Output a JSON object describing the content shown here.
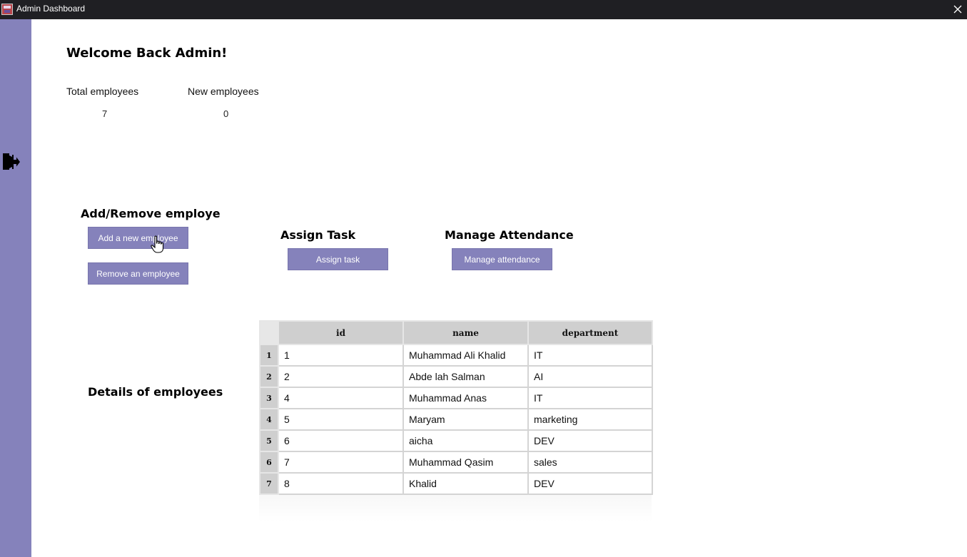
{
  "window": {
    "title": "Admin Dashboard",
    "close_icon": "close-icon",
    "app_icon": "app-icon"
  },
  "sidebar": {
    "color": "#8582bb",
    "logout_icon": "logout-icon"
  },
  "header": {
    "welcome": "Welcome Back Admin!"
  },
  "stats": {
    "total_label": "Total employees",
    "total_value": "7",
    "new_label": "New employees",
    "new_value": "0"
  },
  "add_remove": {
    "title": "Add/Remove employe",
    "add_label": "Add a new employee",
    "remove_label": "Remove an employee"
  },
  "assign": {
    "title": "Assign Task",
    "button_label": "Assign task"
  },
  "attendance": {
    "title": "Manage Attendance",
    "button_label": "Manage attendance"
  },
  "details": {
    "title": "Details of employees"
  },
  "table": {
    "columns": [
      "id",
      "name",
      "department"
    ],
    "rows": [
      {
        "num": "1",
        "id": "1",
        "name": "Muhammad Ali Khalid",
        "department": "IT"
      },
      {
        "num": "2",
        "id": "2",
        "name": "Abde lah Salman",
        "department": "AI"
      },
      {
        "num": "3",
        "id": "4",
        "name": "Muhammad Anas",
        "department": "IT"
      },
      {
        "num": "4",
        "id": "5",
        "name": "Maryam",
        "department": "marketing"
      },
      {
        "num": "5",
        "id": "6",
        "name": "aicha",
        "department": "DEV"
      },
      {
        "num": "6",
        "id": "7",
        "name": "Muhammad Qasim",
        "department": "sales"
      },
      {
        "num": "7",
        "id": "8",
        "name": "Khalid",
        "department": "DEV"
      }
    ]
  },
  "colors": {
    "accent": "#8582bb",
    "titlebar": "#1f1f23",
    "table_header": "#cfcfcf"
  }
}
